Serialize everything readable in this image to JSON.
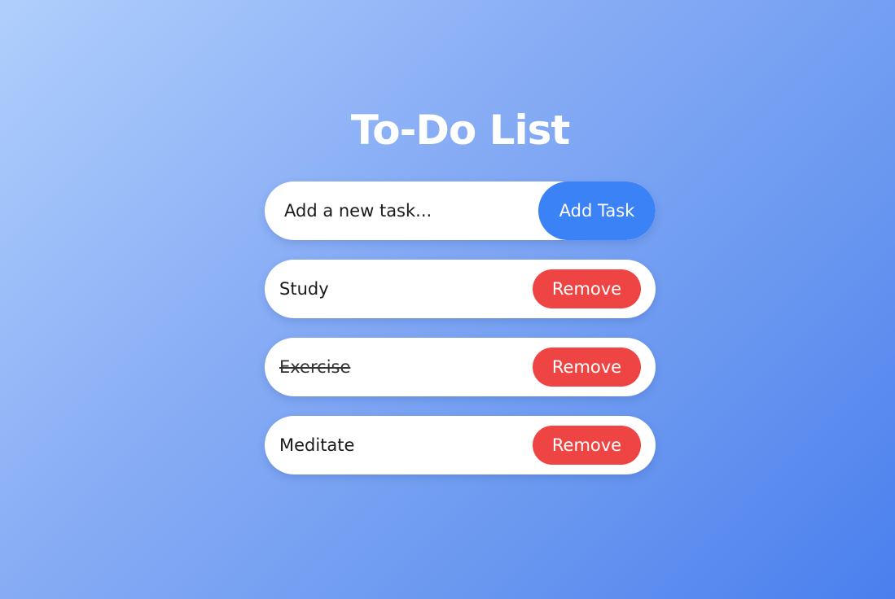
{
  "header": {
    "title": "To-Do List"
  },
  "new_task": {
    "value": "",
    "placeholder": "Add a new task...",
    "add_label": "Add Task"
  },
  "tasks": [
    {
      "label": "Study",
      "completed": false,
      "remove_label": "Remove"
    },
    {
      "label": "Exercise",
      "completed": true,
      "remove_label": "Remove"
    },
    {
      "label": "Meditate",
      "completed": false,
      "remove_label": "Remove"
    }
  ],
  "colors": {
    "accent": "#3b82f6",
    "danger": "#ef4444",
    "card": "#ffffff",
    "title": "#ffffff"
  }
}
